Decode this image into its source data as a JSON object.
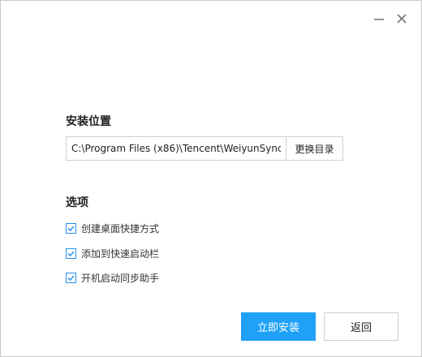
{
  "window": {
    "minimize_icon": "minimize-icon",
    "close_icon": "close-icon"
  },
  "install_location": {
    "title": "安装位置",
    "path_value": "C:\\Program Files (x86)\\Tencent\\WeiyunSync",
    "change_dir_label": "更换目录"
  },
  "options": {
    "title": "选项",
    "items": [
      {
        "label": "创建桌面快捷方式",
        "checked": true
      },
      {
        "label": "添加到快速启动栏",
        "checked": true
      },
      {
        "label": "开机启动同步助手",
        "checked": true
      }
    ]
  },
  "actions": {
    "install_label": "立即安装",
    "back_label": "返回"
  },
  "colors": {
    "accent": "#1ea1f7",
    "checkbox_border": "#2a8ff0"
  }
}
